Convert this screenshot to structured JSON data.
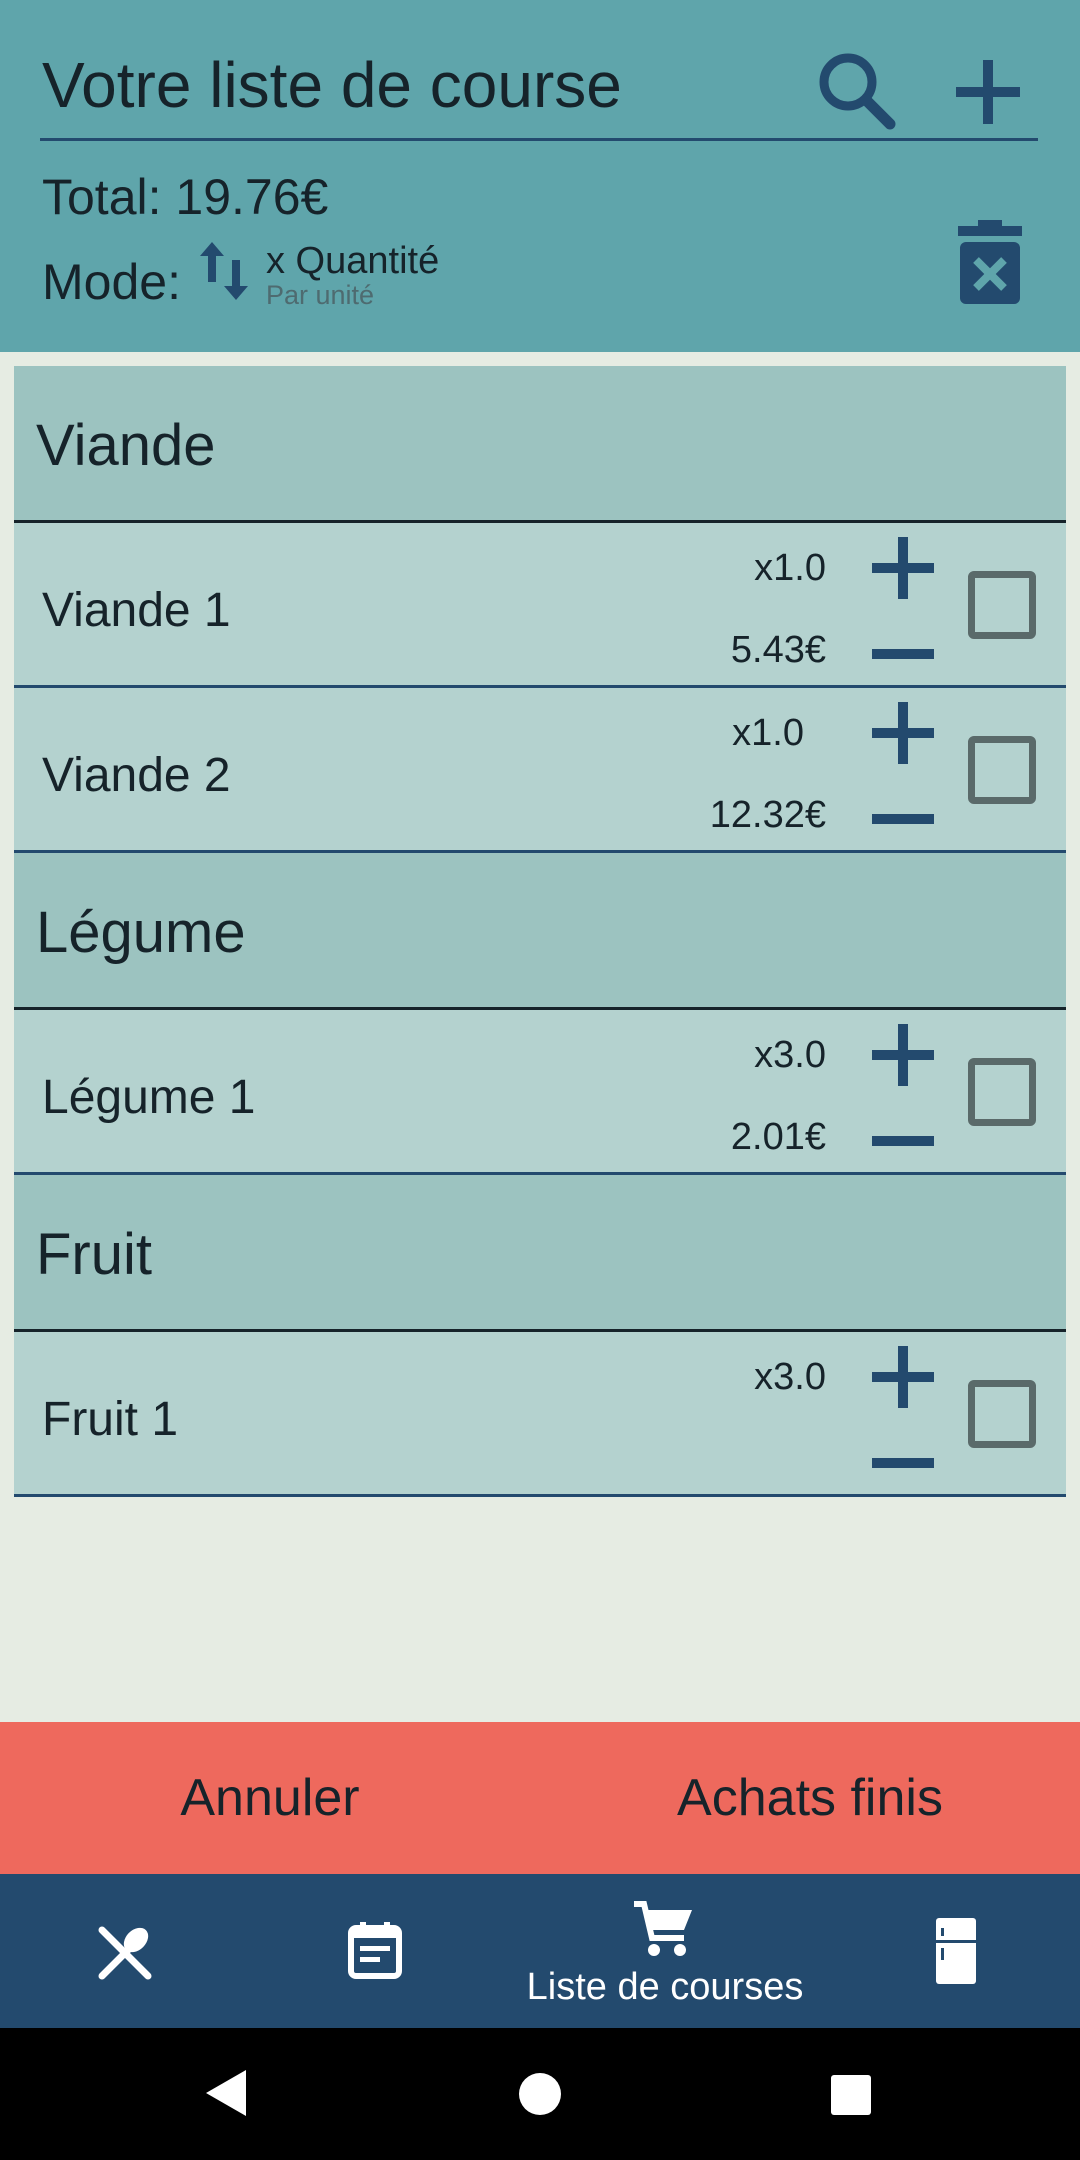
{
  "header": {
    "title": "Votre liste de course",
    "total": "Total: 19.76€",
    "mode_label": "Mode:",
    "mode_value": "x Quantité",
    "mode_sub": "Par unité"
  },
  "categories": [
    {
      "name": "Viande",
      "items": [
        {
          "name": "Viande 1",
          "qty": "x1.0",
          "price": "5.43€"
        },
        {
          "name": "Viande 2",
          "qty": "x1.0",
          "price": "12.32€"
        }
      ]
    },
    {
      "name": "Légume",
      "items": [
        {
          "name": "Légume 1",
          "qty": "x3.0",
          "price": "2.01€"
        }
      ]
    },
    {
      "name": "Fruit",
      "items": [
        {
          "name": "Fruit 1",
          "qty": "x3.0",
          "price": ""
        }
      ]
    }
  ],
  "actions": {
    "cancel": "Annuler",
    "finish": "Achats finis"
  },
  "nav": {
    "active_label": "Liste de courses"
  },
  "colors": {
    "header_bg": "#5fa5ab",
    "accent": "#234a6e",
    "action_bg": "#ee695d",
    "category_bg": "#9cc3c0",
    "item_bg": "#b4d2cf"
  }
}
